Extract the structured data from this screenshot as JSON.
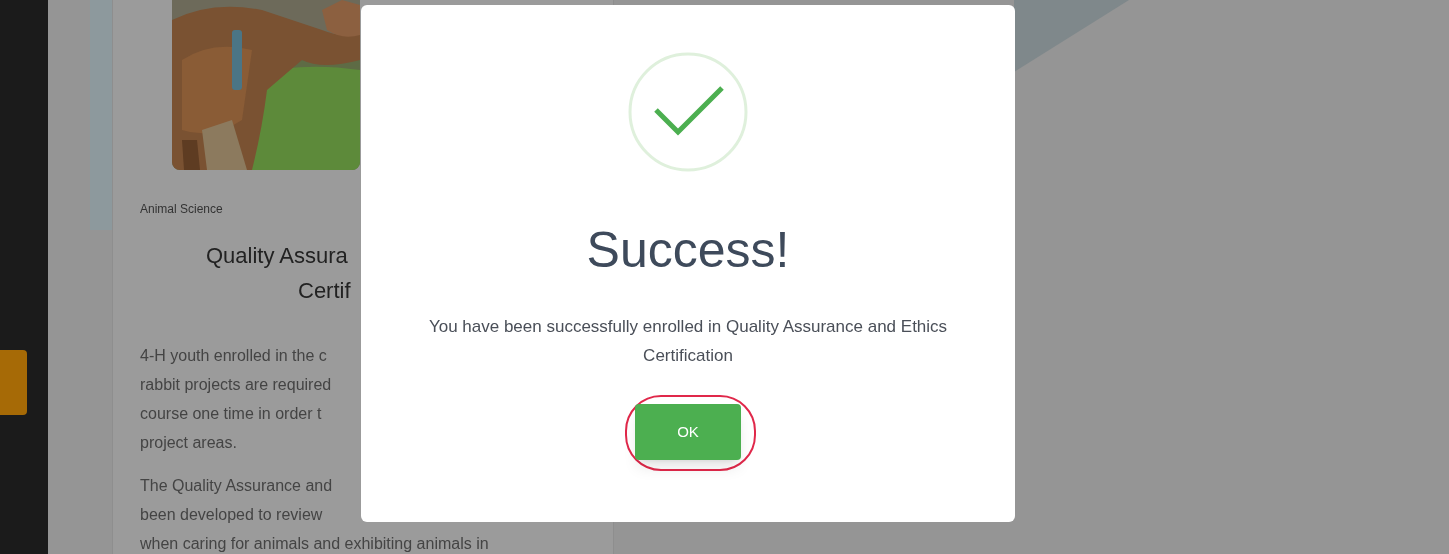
{
  "card": {
    "category": "Animal Science",
    "title_lines": [
      "Quality Assura",
      "Certif"
    ],
    "paragraphs": [
      [
        "4-H youth enrolled in the c",
        "rabbit projects are required",
        "course one time in order t",
        "project areas."
      ],
      [
        "The Quality Assurance and",
        "been developed to review",
        "when caring for animals and exhibiting animals in"
      ]
    ]
  },
  "dialog": {
    "title": "Success!",
    "message": "You have been successfully enrolled in Quality Assurance and Ethics Certification",
    "button": {
      "label": "OK",
      "highlighted": true
    }
  }
}
